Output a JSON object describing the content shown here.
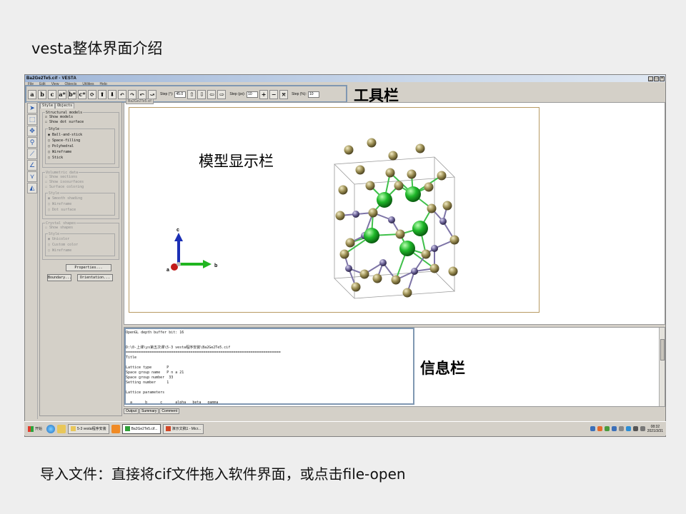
{
  "slide": {
    "title": "vesta整体界面介绍",
    "footer": "导入文件：直接将cif文件拖入软件界面，或点击file-open"
  },
  "annotations": {
    "toolbar": "工具栏",
    "model_display": "模型显示栏",
    "info": "信息栏"
  },
  "window": {
    "title": "Ba2Ge2Te5.cif - VESTA",
    "controls": [
      "_",
      "□",
      "×"
    ],
    "menus": [
      "File",
      "Edit",
      "View",
      "Objects",
      "Utilities",
      "Help"
    ]
  },
  "toolbar": {
    "axis_buttons": [
      "a",
      "b",
      "c",
      "a*",
      "b*",
      "c*"
    ],
    "step_deg_label": "Step (°):",
    "step_deg_value": "45.0",
    "step_px_label": "Step (px):",
    "step_px_value": "10",
    "step_pct_label": "Step (%):",
    "step_pct_value": "10"
  },
  "tools": [
    "pointer-icon",
    "select-icon",
    "translate-icon",
    "magnify-icon",
    "distance-icon",
    "angle-icon",
    "dihedral-icon",
    "boundary-icon"
  ],
  "panel": {
    "tabs": [
      "Style",
      "Objects"
    ],
    "structural_models": {
      "title": "Structural models",
      "show_models": "Show models",
      "show_dot_surface": "Show dot surface",
      "style_title": "Style",
      "styles": [
        "Ball-and-stick",
        "Space-filling",
        "Polyhedral",
        "Wireframe",
        "Stick"
      ],
      "selected_style": "Ball-and-stick"
    },
    "volumetric": {
      "title": "Volumetric data",
      "items": [
        "Show sections",
        "Show isosurfaces",
        "Surface coloring"
      ],
      "style_title": "Style",
      "styles": [
        "Smooth shading",
        "Wireframe",
        "Dot surface"
      ]
    },
    "crystal": {
      "title": "Crystal shapes",
      "show": "Show shapes",
      "style_title": "Style",
      "styles": [
        "Unicolor",
        "Custom color",
        "Wireframe"
      ]
    },
    "properties_button": "Properties...",
    "boundary_button": "Boundary...",
    "orientation_button": "Orientation..."
  },
  "viewport": {
    "tab": "Ba2Ge2Te5.cif",
    "axes": [
      "a",
      "b",
      "c"
    ]
  },
  "log": {
    "lines": [
      "OpenGL depth buffer bit: 16",
      "",
      "",
      "D:\\0-上课\\ys第五次课\\5-3 vesta程序安装\\Ba2Ge2Te5.cif",
      "========================================================================",
      "Title",
      "",
      "Lattice type       P",
      "Space group name   P n a 21",
      "Space group number  33",
      "Setting number     1",
      "",
      "Lattice parameters",
      "",
      "  a      b      c      alpha   beta   gamma"
    ],
    "tabs": [
      "Output",
      "Summary",
      "Comment"
    ]
  },
  "taskbar": {
    "start": "开始",
    "tasks": [
      "5-3 vesta程序安装",
      "Ba2Ge2Te5.cif...",
      "演示文稿1 - Micr..."
    ],
    "time": "08:32",
    "date": "2021/3/31"
  },
  "colors": {
    "ge_atom": "#1fb82a",
    "te_atom": "#9a8d52",
    "ba_atom": "#6a6196",
    "axis_a": "#c21b1b",
    "axis_b": "#20b520",
    "axis_c": "#1b2fb5",
    "frame": "#7f97b2"
  }
}
